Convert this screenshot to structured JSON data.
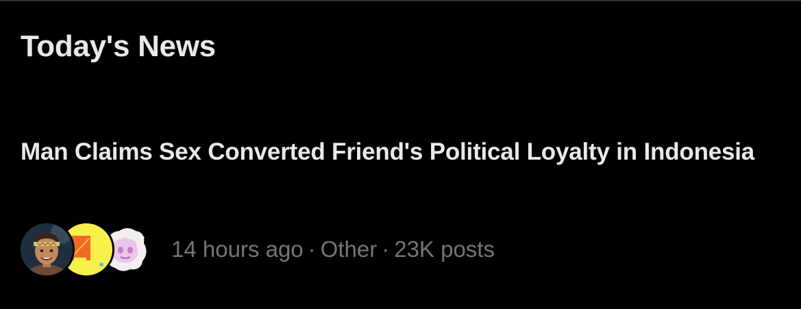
{
  "section": {
    "title": "Today's News"
  },
  "news_item": {
    "headline": "Man Claims Sex Converted Friend's Political Loyalty in Indonesia",
    "time_ago": "14 hours ago",
    "separator": "·",
    "category": "Other",
    "post_count": "23K posts"
  },
  "avatars": [
    {
      "icon": "cartoon-person-avatar"
    },
    {
      "icon": "yellow-circle-logo-avatar",
      "accent": "#f8f04a"
    },
    {
      "icon": "pastel-character-avatar"
    }
  ],
  "colors": {
    "background": "#000000",
    "primary_text": "#e7e9ea",
    "secondary_text": "#71767b"
  }
}
